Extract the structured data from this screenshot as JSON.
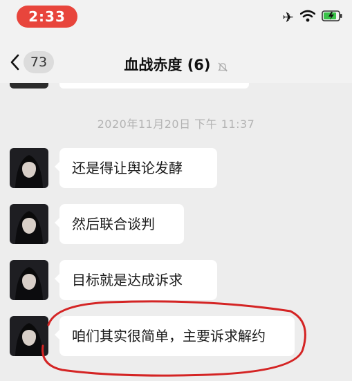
{
  "status_bar": {
    "time": "2:33",
    "icons": [
      "airplane-icon",
      "wifi-icon",
      "battery-charging-icon"
    ],
    "time_pill_color": "#e8453c"
  },
  "header": {
    "unread_count": "73",
    "title": "血战赤度 (6)",
    "icons": [
      "back-chevron-icon",
      "mute-bell-icon"
    ]
  },
  "chat": {
    "timestamp": "2020年11月20日 下午 11:37",
    "messages": [
      {
        "text": "还是得让舆论发酵"
      },
      {
        "text": "然后联合谈判"
      },
      {
        "text": "目标就是达成诉求"
      },
      {
        "text": "咱们其实很简单，主要诉求解约"
      }
    ],
    "highlight_color": "#d42424"
  }
}
